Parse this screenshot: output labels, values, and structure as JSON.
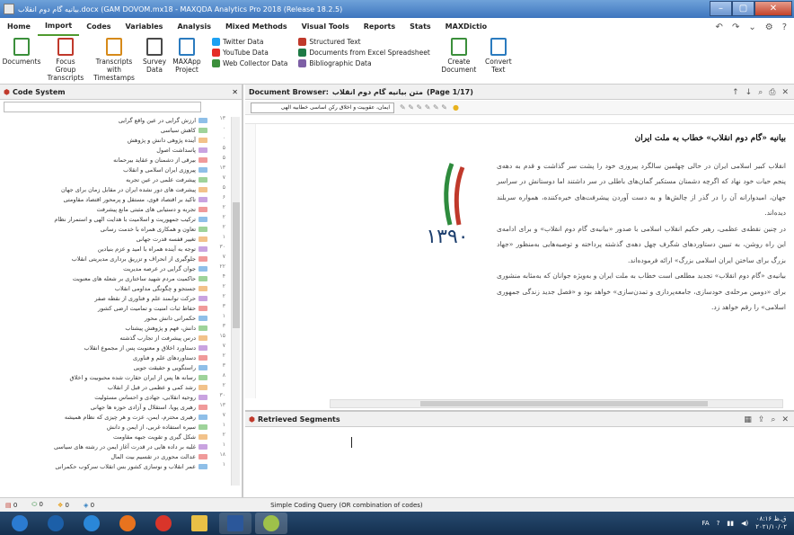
{
  "window": {
    "title": "بیانیه گام دوم انقلاب.docx (GAM DOVOM.mx18 - MAXQDA Analytics Pro 2018 (Release 18.2.5)",
    "controls": [
      "–",
      "▢",
      "✕"
    ]
  },
  "menu": {
    "tabs": [
      "Home",
      "Import",
      "Codes",
      "Variables",
      "Analysis",
      "Mixed Methods",
      "Visual Tools",
      "Reports",
      "Stats",
      "MAXDictio"
    ],
    "active": "Import"
  },
  "ribbon": {
    "buttons": [
      {
        "label": "Documents",
        "color": "#3b8f3b",
        "icon": "import-documents-icon"
      },
      {
        "label": "Focus Group Transcripts",
        "color": "#c0392b",
        "icon": "focus-group-icon"
      },
      {
        "label": "Transcripts with Timestamps",
        "color": "#d68a1a",
        "icon": "transcripts-icon"
      },
      {
        "label": "Survey Data",
        "color": "#4a4a4a",
        "icon": "survey-icon"
      },
      {
        "label": "MAXApp Project",
        "color": "#2b7bbf",
        "icon": "maxapp-icon"
      }
    ],
    "list1": [
      {
        "label": "Twitter Data",
        "color": "#1da1f2",
        "icon": "twitter-icon"
      },
      {
        "label": "YouTube Data",
        "color": "#e52d27",
        "icon": "youtube-icon"
      },
      {
        "label": "Web Collector Data",
        "color": "#3c8f3c",
        "icon": "web-collector-icon"
      }
    ],
    "list2": [
      {
        "label": "Structured Text",
        "color": "#c0392b",
        "icon": "structured-text-icon"
      },
      {
        "label": "Documents from Excel Spreadsheet",
        "color": "#1e7a45",
        "icon": "excel-icon"
      },
      {
        "label": "Bibliographic Data",
        "color": "#7d5fa5",
        "icon": "bibliographic-icon"
      }
    ],
    "create": {
      "label": "Create Document",
      "icon": "create-document-icon"
    },
    "convert": {
      "label": "Convert Text",
      "icon": "convert-text-icon"
    }
  },
  "code_system": {
    "title": "Code System",
    "codes": [
      {
        "text": "ارزش گرایی در عین واقع گرایی",
        "num": "۱۳"
      },
      {
        "text": "کاهش سیاسی",
        "num": "۰"
      },
      {
        "text": "آینده پژوهی دانش و پژوهش",
        "num": "۰"
      },
      {
        "text": "پاسداشت اصول",
        "num": "۵"
      },
      {
        "text": "بیرقی از دشمنان و عقاید بیرحمانه",
        "num": "۵"
      },
      {
        "text": "پیروزی ایران اسلامی و انقلاب",
        "num": "۱۳"
      },
      {
        "text": "پیشرفت علمی در عین تجربه",
        "num": "۷"
      },
      {
        "text": "پیشرفت های دور نشده ایران در مقابل زمان برای جهان",
        "num": "۵"
      },
      {
        "text": "تاکید بر اقتصاد قوی، مستقل و پرمحور اقتصاد مقاومتی",
        "num": "۶"
      },
      {
        "text": "تجربه و دستیابی های مثبتی مانع پیشرفت",
        "num": "۲"
      },
      {
        "text": "ترکیب جمهوریت و اسلامیت با هدایت الهی و استمرار نظام",
        "num": "۲"
      },
      {
        "text": "تعاون و همکاری همراه با خدمت رسانی",
        "num": "۲"
      },
      {
        "text": "تغییر قفسه قدرت جهانی",
        "num": "۱"
      },
      {
        "text": "توجه به آینده همراه با امید و عزم بنیادین",
        "num": "۳۰"
      },
      {
        "text": "جلوگیری از انحراف و تزریق برداری مدیریتی انقلاب",
        "num": "۷"
      },
      {
        "text": "جوان گرایی در عرصه مدیریت",
        "num": "۲۲"
      },
      {
        "text": "حاکمیت مردم شهید ساختاری بر شعله های معنویت",
        "num": "۴"
      },
      {
        "text": "جستجو و چگونگی مداومی انقلاب",
        "num": "۲"
      },
      {
        "text": "حرکت توانمند علم و فناوری از نقطه صفر",
        "num": "۲"
      },
      {
        "text": "حفاظ ثبات امنیت و تمامیت ارضی کشور",
        "num": "۳"
      },
      {
        "text": "حکمرانی دانش محور",
        "num": "۱"
      },
      {
        "text": "دانش، فهم و پژوهش پیشتاب",
        "num": "۳"
      },
      {
        "text": "درس پیشرفت از تجارب گذشته",
        "num": "۱۵"
      },
      {
        "text": "دستاورد اخلاق و معنویت پس از مجموع انقلاب",
        "num": "۷"
      },
      {
        "text": "دستاوردهای علم و فناوری",
        "num": "۲"
      },
      {
        "text": "راستگویی و حقیقت جویی",
        "num": "۳"
      },
      {
        "text": "رسانه ها پس از ایران حقارت شده محبوبیت و اخلاق",
        "num": "۸"
      },
      {
        "text": "رشد کمی و عظمی در قبل از انقلاب",
        "num": "۲"
      },
      {
        "text": "روحیه انقلابی، جهادی و احساس مسئولیت",
        "num": "۳۰"
      },
      {
        "text": "رهبری پویا، استقلال و آزادی حوزه ها جهانی",
        "num": "۱۳"
      },
      {
        "text": "رهبری محترم، ایمن، عزت و هر چیزی که نظام همیشه",
        "num": "۷"
      },
      {
        "text": "سیره استفاده غربی، از ایمن و دانش",
        "num": "۱"
      },
      {
        "text": "شکل گیری و تقویت جبهه مقاومت",
        "num": "۲"
      },
      {
        "text": "غلبه بر داده هایی در قدرت آغاز ایمن در رشته های سیاسی",
        "num": "۱"
      },
      {
        "text": "عدالت محوری در تقسیم بیت المال",
        "num": "۱۸"
      },
      {
        "text": "عمر انقلاب و نوسازی کشور بس انقلاب سرکوب حکمرانی",
        "num": "۱"
      }
    ]
  },
  "document_browser": {
    "title": "Document Browser:",
    "doc_name": "متن بیانیه گام دوم انقلاب",
    "page": "(Page 1/17)",
    "code_dropdown": "ایمان، عقوبیت و اخلاق رکن اساسی خطابیه الهی",
    "heading": "بیانیه «گام دوم انقلاب» خطاب به ملت ایران",
    "paragraphs": [
      "انقلاب کبیر اسلامی ایران در حالی چهلمین سالگرد پیروزی خود را پشت سر گذاشت و قدم به دهه‌ی پنجم حیات خود نهاد که اگرچه دشمنان مستکبر گمان‌های باطلی در سر داشتند اما دوستانش در سراسر جهان، امیدوارانه آن را در گذر از چالش‌ها و به دست آوردن پیشرفت‌های خیره‌کننده، همواره سربلند دیده‌اند.",
      "در چنین نقطه‌ی عظمی، رهبر حکیم انقلاب اسلامی با صدور «بیانیه‌ی گام دوم انقلاب» و برای ادامه‌ی این راه روشن، به تبیین دستاوردهای شگرف چهل دهه‌ی گذشته پرداخته و توصیه‌هایی به‌منظور «جهاد بزرگ برای ساختن ایران اسلامی بزرگ» ارائه فرموده‌اند.",
      "بیانیه‌ی «گام دوم انقلاب» تجدید مطلعی است خطاب به ملت ایران و به‌ویژه جوانان که به‌مثابه منشوری برای «دومین مرحله‌ی خودسازی، جامعه‌پردازی و تمدن‌سازی» خواهد بود و «فصل جدید زندگی جمهوری اسلامی» را رقم خواهد زد."
    ],
    "logo_text": "۱۳۹۰"
  },
  "retrieved_segments": {
    "title": "Retrieved Segments"
  },
  "status_bar": {
    "items": [
      {
        "label": "0",
        "icon": "document-count-icon"
      },
      {
        "label": "0",
        "icon": "code-count-icon"
      },
      {
        "label": "0",
        "icon": "memo-count-icon"
      },
      {
        "label": "0",
        "icon": "variable-count-icon"
      }
    ],
    "query": "Simple Coding Query (OR combination of codes)"
  },
  "taskbar": {
    "apps": [
      {
        "name": "start",
        "color": "#2b7bd1"
      },
      {
        "name": "media",
        "color": "#1c5fa8"
      },
      {
        "name": "ie",
        "color": "#2a87d8"
      },
      {
        "name": "firefox",
        "color": "#e8731e"
      },
      {
        "name": "chrome",
        "color": "#d9352a"
      },
      {
        "name": "explorer",
        "color": "#e9c046"
      },
      {
        "name": "word",
        "color": "#2b579a"
      },
      {
        "name": "maxqda",
        "color": "#9ec14a"
      }
    ],
    "lang": "FA",
    "time": "۰۸:۱۶ ق.ظ",
    "date": "۲۰۲۱/۱۰/۰۲"
  }
}
